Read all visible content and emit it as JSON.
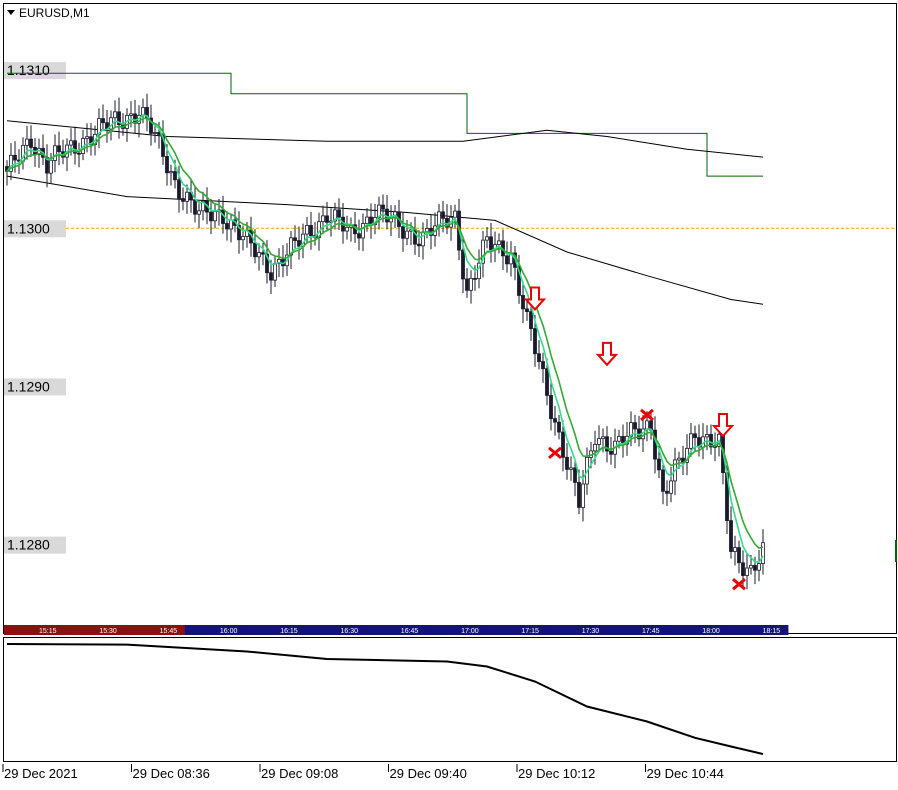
{
  "window": {
    "symbol_title": "EURUSD,M1"
  },
  "chart_data": {
    "type": "candlestick",
    "price_axis": {
      "labels": [
        "1.1310",
        "1.1300",
        "1.1290",
        "1.1280"
      ],
      "values": [
        1.131,
        1.13,
        1.129,
        1.128
      ],
      "range": [
        1.12765,
        1.13138
      ],
      "dashed_level": 1.13
    },
    "session_bar": {
      "labels": [
        "15:15",
        "15:30",
        "15:45",
        "16:00",
        "16:15",
        "16:30",
        "16:45",
        "17:00",
        "17:15",
        "17:30",
        "17:45",
        "18:00",
        "18:15"
      ],
      "red_until": "16:00"
    },
    "time_axis_labels": [
      "29 Dec 2021",
      "29 Dec 08:36",
      "29 Dec 09:08",
      "29 Dec 09:40",
      "29 Dec 10:12",
      "29 Dec 10:44"
    ],
    "anchor_points": [
      {
        "i": 0,
        "p": 1.13033
      },
      {
        "i": 6,
        "p": 1.13058
      },
      {
        "i": 10,
        "p": 1.1304
      },
      {
        "i": 20,
        "p": 1.13058
      },
      {
        "i": 33,
        "p": 1.13075
      },
      {
        "i": 36,
        "p": 1.13062
      },
      {
        "i": 42,
        "p": 1.1303
      },
      {
        "i": 48,
        "p": 1.13008
      },
      {
        "i": 54,
        "p": 1.1301
      },
      {
        "i": 60,
        "p": 1.1299
      },
      {
        "i": 66,
        "p": 1.12975
      },
      {
        "i": 72,
        "p": 1.12988
      },
      {
        "i": 80,
        "p": 1.1301
      },
      {
        "i": 86,
        "p": 1.12995
      },
      {
        "i": 92,
        "p": 1.13012
      },
      {
        "i": 98,
        "p": 1.13
      },
      {
        "i": 104,
        "p": 1.12995
      },
      {
        "i": 112,
        "p": 1.13008
      },
      {
        "i": 115,
        "p": 1.1296
      },
      {
        "i": 120,
        "p": 1.1299
      },
      {
        "i": 126,
        "p": 1.12985
      },
      {
        "i": 130,
        "p": 1.1294
      },
      {
        "i": 134,
        "p": 1.12905
      },
      {
        "i": 138,
        "p": 1.1287
      },
      {
        "i": 143,
        "p": 1.12825
      },
      {
        "i": 147,
        "p": 1.1287
      },
      {
        "i": 152,
        "p": 1.12862
      },
      {
        "i": 158,
        "p": 1.12872
      },
      {
        "i": 161,
        "p": 1.12878
      },
      {
        "i": 164,
        "p": 1.1283
      },
      {
        "i": 168,
        "p": 1.1285
      },
      {
        "i": 172,
        "p": 1.12872
      },
      {
        "i": 178,
        "p": 1.12862
      },
      {
        "i": 181,
        "p": 1.12795
      },
      {
        "i": 186,
        "p": 1.12785
      },
      {
        "i": 189,
        "p": 1.12795
      }
    ],
    "candle_count": 190,
    "moving_averages": [
      {
        "name": "",
        "color": "#33dd88",
        "period": 5
      },
      {
        "name": "",
        "color": "#33aa33",
        "period": 9
      },
      {
        "name": "",
        "color": "#000000",
        "role": "slow_line_1",
        "points": [
          [
            0,
            1.13033
          ],
          [
            30,
            1.1302
          ],
          [
            70,
            1.13015
          ],
          [
            100,
            1.1301
          ],
          [
            122,
            1.13005
          ],
          [
            140,
            1.12985
          ],
          [
            160,
            1.1297
          ],
          [
            181,
            1.12955
          ],
          [
            189,
            1.12952
          ]
        ]
      },
      {
        "name": "",
        "color": "#000000",
        "role": "slow_line_2",
        "points": [
          [
            0,
            1.13068
          ],
          [
            40,
            1.13058
          ],
          [
            80,
            1.13055
          ],
          [
            114,
            1.13055
          ],
          [
            135,
            1.13062
          ],
          [
            150,
            1.13058
          ],
          [
            170,
            1.1305
          ],
          [
            189,
            1.13045
          ]
        ]
      },
      {
        "name": "",
        "color": "#006600",
        "role": "step_line",
        "points": [
          [
            0,
            1.13098
          ],
          [
            56,
            1.13098
          ],
          [
            56,
            1.13085
          ],
          [
            115,
            1.13085
          ],
          [
            115,
            1.1306
          ],
          [
            175,
            1.1306
          ],
          [
            175,
            1.13033
          ],
          [
            189,
            1.13033
          ]
        ]
      }
    ],
    "signals": {
      "down_arrows": [
        {
          "i": 132,
          "p": 1.12955
        },
        {
          "i": 150,
          "p": 1.1292
        },
        {
          "i": 179,
          "p": 1.12875
        }
      ],
      "x_marks": [
        {
          "i": 137,
          "p": 1.12858
        },
        {
          "i": 160,
          "p": 1.12882
        },
        {
          "i": 183,
          "p": 1.12775
        }
      ]
    },
    "indicator_line": [
      [
        0,
        0
      ],
      [
        30,
        -0.5
      ],
      [
        60,
        -6
      ],
      [
        80,
        -12
      ],
      [
        110,
        -14
      ],
      [
        120,
        -18
      ],
      [
        132,
        -30
      ],
      [
        145,
        -50
      ],
      [
        160,
        -62
      ],
      [
        172,
        -75
      ],
      [
        181,
        -82
      ],
      [
        189,
        -88
      ]
    ],
    "grid": false
  }
}
